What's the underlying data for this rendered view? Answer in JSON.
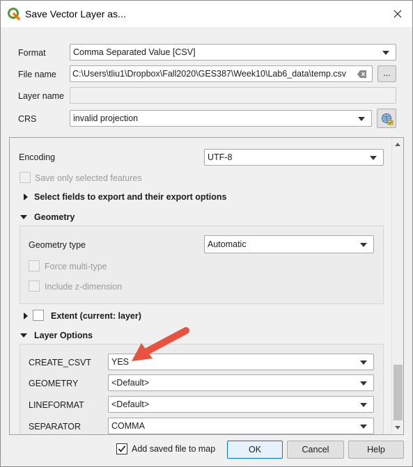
{
  "window": {
    "title": "Save Vector Layer as..."
  },
  "form": {
    "format_label": "Format",
    "format_value": "Comma Separated Value [CSV]",
    "filename_label": "File name",
    "filename_value": "C:\\Users\\tliu1\\Dropbox\\Fall2020\\GES387\\Week10\\Lab6_data\\temp.csv",
    "browse_label": "...",
    "layername_label": "Layer name",
    "layername_value": "",
    "crs_label": "CRS",
    "crs_value": "invalid projection"
  },
  "options": {
    "encoding_label": "Encoding",
    "encoding_value": "UTF-8",
    "save_selected_label": "Save only selected features",
    "select_fields_label": "Select fields to export and their export options",
    "geometry_header": "Geometry",
    "geometry_type_label": "Geometry type",
    "geometry_type_value": "Automatic",
    "force_multi_label": "Force multi-type",
    "include_z_label": "Include z-dimension",
    "extent_label": "Extent (current: layer)",
    "layer_options_header": "Layer Options",
    "layer_options": [
      {
        "key": "CREATE_CSVT",
        "value": "YES"
      },
      {
        "key": "GEOMETRY",
        "value": "<Default>"
      },
      {
        "key": "LINEFORMAT",
        "value": "<Default>"
      },
      {
        "key": "SEPARATOR",
        "value": "COMMA"
      }
    ]
  },
  "footer": {
    "add_saved_label": "Add saved file to map",
    "add_saved_checked": true,
    "ok_label": "OK",
    "cancel_label": "Cancel",
    "help_label": "Help"
  },
  "colors": {
    "qgis_green": "#589632",
    "qgis_yellow": "#ee7913",
    "arrow_red": "#e8523f",
    "focus_blue": "#0078d7"
  }
}
